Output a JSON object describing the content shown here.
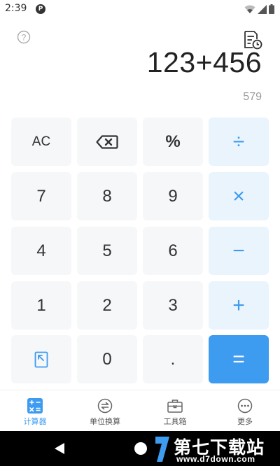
{
  "status_bar": {
    "time": "2:39",
    "app_badge": "P",
    "icons": [
      "wifi-icon",
      "signal-icon",
      "battery-icon"
    ]
  },
  "display": {
    "expression": "123+456",
    "result": "579"
  },
  "colors": {
    "accent": "#3d9bf0",
    "operator_bg": "#eaf4fd",
    "key_bg": "#f6f7f9"
  },
  "keys": {
    "ac": "AC",
    "backspace_icon": "backspace-icon",
    "percent": "%",
    "divide": "÷",
    "seven": "7",
    "eight": "8",
    "nine": "9",
    "multiply": "×",
    "four": "4",
    "five": "5",
    "six": "6",
    "minus": "−",
    "one": "1",
    "two": "2",
    "three": "3",
    "plus": "+",
    "collapse_icon": "collapse-icon",
    "zero": "0",
    "dot": ".",
    "equals": "="
  },
  "tabs": [
    {
      "label": "计算器",
      "icon": "calculator-icon",
      "active": true
    },
    {
      "label": "单位换算",
      "icon": "unit-convert-icon",
      "active": false
    },
    {
      "label": "工具箱",
      "icon": "toolbox-icon",
      "active": false
    },
    {
      "label": "更多",
      "icon": "more-icon",
      "active": false
    }
  ],
  "watermark": {
    "title": "第七下载站",
    "url": "www.d7down.com"
  }
}
